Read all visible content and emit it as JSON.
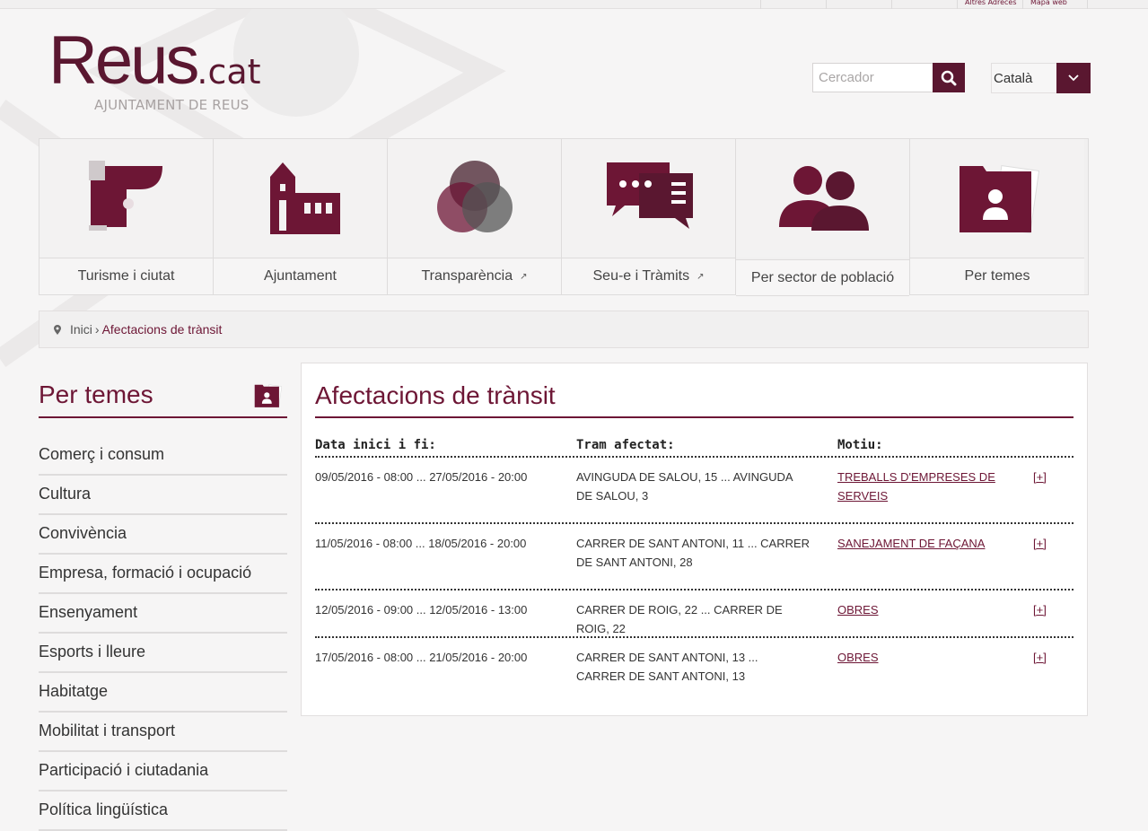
{
  "topbar": {
    "links": [
      "Altres Adreces",
      "Mapa web"
    ]
  },
  "header": {
    "logo_main": "Reus",
    "logo_suffix": ".cat",
    "logo_sub": "AJUNTAMENT DE REUS",
    "search_placeholder": "Cercador",
    "language": "Català"
  },
  "nav": [
    {
      "label": "Turisme i ciutat",
      "icon": "tourism-icon",
      "external": false
    },
    {
      "label": "Ajuntament",
      "icon": "city-hall-icon",
      "external": false
    },
    {
      "label": "Transparència",
      "icon": "transparency-icon",
      "external": true
    },
    {
      "label": "Seu-e i Tràmits",
      "icon": "chat-bubbles-icon",
      "external": true
    },
    {
      "label": "Per sector de població",
      "icon": "people-icon",
      "external": false
    },
    {
      "label": "Per temes",
      "icon": "folder-user-icon",
      "external": false
    }
  ],
  "breadcrumb": {
    "home": "Inici",
    "separator": "›",
    "current": "Afectacions de trànsit"
  },
  "sidebar": {
    "title": "Per temes",
    "items": [
      "Comerç i consum",
      "Cultura",
      "Convivència",
      "Empresa, formació i ocupació",
      "Ensenyament",
      "Esports i lleure",
      "Habitatge",
      "Mobilitat i transport",
      "Participació i ciutadania",
      "Política lingüística"
    ]
  },
  "main": {
    "title": "Afectacions de trànsit",
    "columns": [
      "Data inici i fi:",
      "Tram afectat:",
      "Motiu:"
    ],
    "more_label": "[+]",
    "rows": [
      {
        "date": "09/05/2016 - 08:00 ... 27/05/2016 - 20:00",
        "tram": "AVINGUDA DE SALOU, 15 ... AVINGUDA DE SALOU, 3",
        "motiu": "TREBALLS D'EMPRESES DE SERVEIS"
      },
      {
        "date": "11/05/2016 - 08:00 ... 18/05/2016 - 20:00",
        "tram": "CARRER DE SANT ANTONI, 11 ... CARRER DE SANT ANTONI, 28",
        "motiu": "SANEJAMENT DE FAÇANA"
      },
      {
        "date": "12/05/2016 - 09:00 ... 12/05/2016 - 13:00",
        "tram": "CARRER DE ROIG, 22 ... CARRER DE ROIG, 22",
        "motiu": "OBRES"
      },
      {
        "date": "17/05/2016 - 08:00 ... 21/05/2016 - 20:00",
        "tram": "CARRER DE SANT ANTONI, 13 ... CARRER DE SANT ANTONI, 13",
        "motiu": "OBRES"
      }
    ]
  },
  "colors": {
    "brand": "#6d1635",
    "brand_dark": "#5a1730",
    "background": "#f6f5f5"
  }
}
